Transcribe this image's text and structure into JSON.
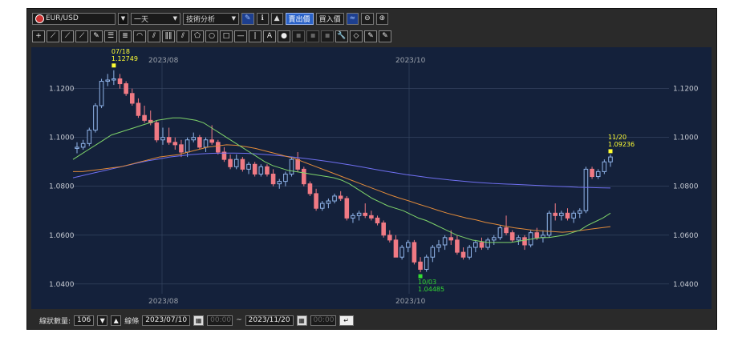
{
  "toolbar": {
    "symbol": "EUR/USD",
    "period": "一天",
    "analysis": "技術分析",
    "sell_price": "賣出價",
    "buy_price": "買入價"
  },
  "tools": [
    "+",
    "⟋",
    "⟋",
    "⟋",
    "✎",
    "☰",
    "≣",
    "◠",
    "⫽",
    "‖‖",
    "⫽",
    "⬠",
    "○",
    "□",
    "—",
    "|",
    "A",
    "●",
    "◾",
    "◾",
    "◾",
    "🔧",
    "◇",
    "✎",
    "✎"
  ],
  "status": {
    "count_label": "線狀數量:",
    "count_value": "106",
    "line_label": "線條",
    "start_date": "2023/07/10",
    "start_time": "00:00",
    "tilde": "~",
    "end_date": "2023/11/20",
    "end_time": "00:00"
  },
  "chart_data": {
    "type": "candlestick",
    "x_labels": [
      "2023/08",
      "2023/10"
    ],
    "y_ticks": [
      "1.1200",
      "1.1000",
      "1.0800",
      "1.0600",
      "1.0400"
    ],
    "ylim": [
      1.036,
      1.133
    ],
    "annotations": [
      {
        "date": "07/18",
        "value": "1.12749",
        "color": "#ffff33"
      },
      {
        "date": "10/03",
        "value": "1.04485",
        "color": "#33dd33"
      },
      {
        "date": "11/20",
        "value": "1.09236",
        "color": "#ffff33"
      }
    ],
    "candles": [
      [
        1.0955,
        1.098,
        1.0935,
        1.096
      ],
      [
        1.096,
        1.099,
        1.095,
        1.0975
      ],
      [
        1.0975,
        1.104,
        1.0965,
        1.103
      ],
      [
        1.103,
        1.114,
        1.102,
        1.113
      ],
      [
        1.113,
        1.124,
        1.112,
        1.123
      ],
      [
        1.123,
        1.126,
        1.121,
        1.1235
      ],
      [
        1.1235,
        1.1275,
        1.1215,
        1.124
      ],
      [
        1.124,
        1.126,
        1.12,
        1.122
      ],
      [
        1.122,
        1.123,
        1.117,
        1.118
      ],
      [
        1.118,
        1.12,
        1.113,
        1.114
      ],
      [
        1.114,
        1.116,
        1.108,
        1.109
      ],
      [
        1.109,
        1.113,
        1.106,
        1.107
      ],
      [
        1.107,
        1.111,
        1.105,
        1.106
      ],
      [
        1.106,
        1.107,
        1.098,
        1.099
      ],
      [
        1.099,
        1.104,
        1.097,
        1.1
      ],
      [
        1.1,
        1.104,
        1.097,
        1.098
      ],
      [
        1.098,
        1.1,
        1.095,
        1.097
      ],
      [
        1.097,
        1.099,
        1.092,
        1.094
      ],
      [
        1.094,
        1.1,
        1.092,
        1.099
      ],
      [
        1.099,
        1.102,
        1.098,
        1.1
      ],
      [
        1.1,
        1.101,
        1.095,
        1.096
      ],
      [
        1.096,
        1.1,
        1.094,
        1.099
      ],
      [
        1.099,
        1.105,
        1.097,
        1.098
      ],
      [
        1.098,
        1.099,
        1.093,
        1.094
      ],
      [
        1.094,
        1.096,
        1.09,
        1.091
      ],
      [
        1.091,
        1.093,
        1.087,
        1.088
      ],
      [
        1.088,
        1.093,
        1.087,
        1.091
      ],
      [
        1.091,
        1.092,
        1.086,
        1.087
      ],
      [
        1.087,
        1.09,
        1.085,
        1.089
      ],
      [
        1.089,
        1.09,
        1.084,
        1.085
      ],
      [
        1.085,
        1.089,
        1.084,
        1.088
      ],
      [
        1.088,
        1.089,
        1.084,
        1.085
      ],
      [
        1.085,
        1.087,
        1.08,
        1.081
      ],
      [
        1.081,
        1.083,
        1.079,
        1.082
      ],
      [
        1.082,
        1.086,
        1.08,
        1.085
      ],
      [
        1.085,
        1.092,
        1.084,
        1.091
      ],
      [
        1.091,
        1.094,
        1.086,
        1.087
      ],
      [
        1.087,
        1.088,
        1.08,
        1.081
      ],
      [
        1.081,
        1.082,
        1.076,
        1.077
      ],
      [
        1.077,
        1.079,
        1.07,
        1.071
      ],
      [
        1.071,
        1.074,
        1.07,
        1.073
      ],
      [
        1.073,
        1.075,
        1.071,
        1.074
      ],
      [
        1.074,
        1.077,
        1.073,
        1.076
      ],
      [
        1.076,
        1.078,
        1.074,
        1.075
      ],
      [
        1.075,
        1.076,
        1.066,
        1.067
      ],
      [
        1.067,
        1.069,
        1.065,
        1.068
      ],
      [
        1.068,
        1.07,
        1.066,
        1.069
      ],
      [
        1.069,
        1.073,
        1.067,
        1.068
      ],
      [
        1.068,
        1.07,
        1.066,
        1.067
      ],
      [
        1.067,
        1.068,
        1.064,
        1.065
      ],
      [
        1.065,
        1.066,
        1.059,
        1.06
      ],
      [
        1.06,
        1.062,
        1.057,
        1.058
      ],
      [
        1.058,
        1.06,
        1.051,
        1.051
      ],
      [
        1.051,
        1.056,
        1.05,
        1.055
      ],
      [
        1.055,
        1.058,
        1.053,
        1.057
      ],
      [
        1.057,
        1.058,
        1.048,
        1.049
      ],
      [
        1.049,
        1.051,
        1.0448,
        1.046
      ],
      [
        1.046,
        1.052,
        1.045,
        1.051
      ],
      [
        1.051,
        1.056,
        1.049,
        1.055
      ],
      [
        1.055,
        1.058,
        1.053,
        1.056
      ],
      [
        1.056,
        1.06,
        1.054,
        1.059
      ],
      [
        1.059,
        1.062,
        1.056,
        1.058
      ],
      [
        1.058,
        1.06,
        1.052,
        1.053
      ],
      [
        1.053,
        1.055,
        1.05,
        1.051
      ],
      [
        1.051,
        1.056,
        1.05,
        1.055
      ],
      [
        1.055,
        1.058,
        1.053,
        1.057
      ],
      [
        1.057,
        1.059,
        1.054,
        1.055
      ],
      [
        1.055,
        1.059,
        1.054,
        1.058
      ],
      [
        1.058,
        1.06,
        1.056,
        1.059
      ],
      [
        1.059,
        1.064,
        1.058,
        1.063
      ],
      [
        1.063,
        1.068,
        1.06,
        1.061
      ],
      [
        1.061,
        1.062,
        1.057,
        1.058
      ],
      [
        1.058,
        1.06,
        1.056,
        1.059
      ],
      [
        1.059,
        1.06,
        1.054,
        1.056
      ],
      [
        1.056,
        1.062,
        1.055,
        1.061
      ],
      [
        1.061,
        1.063,
        1.058,
        1.059
      ],
      [
        1.059,
        1.062,
        1.057,
        1.06
      ],
      [
        1.06,
        1.07,
        1.059,
        1.069
      ],
      [
        1.069,
        1.073,
        1.066,
        1.068
      ],
      [
        1.068,
        1.07,
        1.066,
        1.069
      ],
      [
        1.069,
        1.071,
        1.066,
        1.067
      ],
      [
        1.067,
        1.07,
        1.065,
        1.069
      ],
      [
        1.069,
        1.071,
        1.067,
        1.07
      ],
      [
        1.07,
        1.088,
        1.069,
        1.087
      ],
      [
        1.087,
        1.088,
        1.083,
        1.084
      ],
      [
        1.084,
        1.087,
        1.083,
        1.086
      ],
      [
        1.086,
        1.091,
        1.085,
        1.09
      ],
      [
        1.09,
        1.093,
        1.088,
        1.092
      ]
    ],
    "ma_short": [
      1.091,
      1.093,
      1.095,
      1.097,
      1.099,
      1.101,
      1.102,
      1.103,
      1.104,
      1.105,
      1.106,
      1.107,
      1.1075,
      1.108,
      1.108,
      1.1075,
      1.107,
      1.106,
      1.104,
      1.102,
      1.1,
      1.098,
      1.096,
      1.094,
      1.092,
      1.09,
      1.0885,
      1.0875,
      1.0865,
      1.086,
      1.0855,
      1.085,
      1.0845,
      1.084,
      1.0835,
      1.0825,
      1.081,
      1.079,
      1.077,
      1.075,
      1.0735,
      1.072,
      1.071,
      1.07,
      1.0685,
      1.067,
      1.066,
      1.0645,
      1.063,
      1.0615,
      1.06,
      1.059,
      1.058,
      1.0575,
      1.057,
      1.057,
      1.057,
      1.057,
      1.0575,
      1.058,
      1.0585,
      1.059,
      1.059,
      1.0595,
      1.06,
      1.061,
      1.062,
      1.064,
      1.0655,
      1.067,
      1.069
    ],
    "ma_mid": [
      1.086,
      1.086,
      1.0865,
      1.087,
      1.0875,
      1.088,
      1.089,
      1.09,
      1.091,
      1.092,
      1.0925,
      1.093,
      1.094,
      1.095,
      1.096,
      1.0965,
      1.097,
      1.0968,
      1.0962,
      1.0955,
      1.0945,
      1.0935,
      1.0925,
      1.0915,
      1.09,
      1.0885,
      1.087,
      1.0855,
      1.084,
      1.0825,
      1.081,
      1.0795,
      1.078,
      1.0765,
      1.0752,
      1.074,
      1.0727,
      1.0715,
      1.0702,
      1.069,
      1.068,
      1.067,
      1.0662,
      1.0652,
      1.0645,
      1.0637,
      1.063,
      1.0625,
      1.062,
      1.0617,
      1.0615,
      1.0612,
      1.0615,
      1.062,
      1.0625,
      1.063,
      1.0635
    ],
    "ma_long": [
      1.0835,
      1.0845,
      1.0855,
      1.0865,
      1.0875,
      1.0885,
      1.0895,
      1.0905,
      1.0912,
      1.092,
      1.0925,
      1.093,
      1.0933,
      1.0935,
      1.0936,
      1.0936,
      1.0935,
      1.0933,
      1.093,
      1.0926,
      1.0922,
      1.0917,
      1.0912,
      1.0906,
      1.09,
      1.0893,
      1.0886,
      1.0878,
      1.087,
      1.0862,
      1.0855,
      1.0848,
      1.0842,
      1.0836,
      1.0831,
      1.0826,
      1.0822,
      1.0818,
      1.0815,
      1.0812,
      1.081,
      1.0808,
      1.0806,
      1.0804,
      1.0802,
      1.08,
      1.0798,
      1.0796,
      1.0795,
      1.0794,
      1.0793
    ]
  }
}
